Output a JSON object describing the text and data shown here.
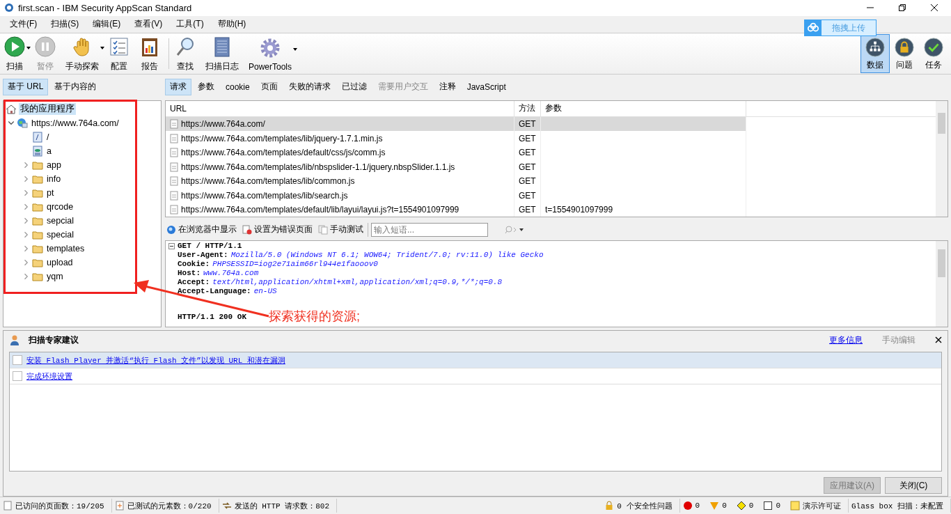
{
  "window": {
    "title": "first.scan - IBM Security AppScan Standard"
  },
  "menu": [
    "文件(F)",
    "扫描(S)",
    "编辑(E)",
    "查看(V)",
    "工具(T)",
    "帮助(H)"
  ],
  "toolbar": [
    {
      "label": "扫描",
      "disabled": false,
      "dropdown": true
    },
    {
      "label": "暂停",
      "disabled": true,
      "dropdown": false
    },
    {
      "label": "手动探索",
      "disabled": false,
      "dropdown": true
    },
    {
      "label": "配置",
      "disabled": false,
      "dropdown": false
    },
    {
      "label": "报告",
      "disabled": false,
      "dropdown": false
    },
    {
      "label": "查找",
      "disabled": false,
      "dropdown": false
    },
    {
      "label": "扫描日志",
      "disabled": false,
      "dropdown": false
    },
    {
      "label": "PowerTools",
      "disabled": false,
      "dropdown": true
    }
  ],
  "views": [
    {
      "label": "数据",
      "selected": true
    },
    {
      "label": "问题",
      "selected": false
    },
    {
      "label": "任务",
      "selected": false
    }
  ],
  "upload_widget": {
    "label": "拖拽上传"
  },
  "left_tabs": [
    {
      "label": "基于 URL",
      "selected": true
    },
    {
      "label": "基于内容的",
      "selected": false
    }
  ],
  "tree": [
    {
      "label": "我的应用程序",
      "kind": "home",
      "selected": true,
      "children": [
        {
          "label": "https://www.764a.com/",
          "kind": "site",
          "selected": false,
          "expanded": true,
          "children": [
            {
              "label": "/",
              "kind": "page",
              "selected": false
            },
            {
              "label": "a",
              "kind": "script",
              "selected": false
            },
            {
              "label": "app",
              "kind": "folder",
              "selected": false,
              "expanded": false
            },
            {
              "label": "info",
              "kind": "folder",
              "selected": false,
              "expanded": false
            },
            {
              "label": "pt",
              "kind": "folder",
              "selected": false,
              "expanded": false
            },
            {
              "label": "qrcode",
              "kind": "folder",
              "selected": false,
              "expanded": false
            },
            {
              "label": "sepcial",
              "kind": "folder",
              "selected": false,
              "expanded": false
            },
            {
              "label": "special",
              "kind": "folder",
              "selected": false,
              "expanded": false
            },
            {
              "label": "templates",
              "kind": "folder",
              "selected": false,
              "expanded": false
            },
            {
              "label": "upload",
              "kind": "folder",
              "selected": false,
              "expanded": false
            },
            {
              "label": "yqm",
              "kind": "folder",
              "selected": false,
              "expanded": false
            }
          ]
        }
      ]
    }
  ],
  "right_tabs": [
    {
      "label": "请求",
      "selected": true,
      "disabled": false
    },
    {
      "label": "参数",
      "selected": false,
      "disabled": false
    },
    {
      "label": "cookie",
      "selected": false,
      "disabled": false
    },
    {
      "label": "页面",
      "selected": false,
      "disabled": false
    },
    {
      "label": "失败的请求",
      "selected": false,
      "disabled": false
    },
    {
      "label": "已过滤",
      "selected": false,
      "disabled": false
    },
    {
      "label": "需要用户交互",
      "selected": false,
      "disabled": true
    },
    {
      "label": "注释",
      "selected": false,
      "disabled": false
    },
    {
      "label": "JavaScript",
      "selected": false,
      "disabled": false
    }
  ],
  "table": {
    "columns": [
      "URL",
      "方法",
      "参数"
    ],
    "rows": [
      {
        "url": "https://www.764a.com/",
        "method": "GET",
        "selected": true
      },
      {
        "url": "https://www.764a.com/templates/lib/jquery-1.7.1.min.js",
        "method": "GET",
        "selected": false
      },
      {
        "url": "https://www.764a.com/templates/default/css/js/comm.js",
        "method": "GET",
        "selected": false
      },
      {
        "url": "https://www.764a.com/templates/lib/nbspslider-1.1/jquery.nbspSlider.1.1.js",
        "method": "GET",
        "selected": false
      },
      {
        "url": "https://www.764a.com/templates/lib/common.js",
        "method": "GET",
        "selected": false
      },
      {
        "url": "https://www.764a.com/templates/lib/search.js",
        "method": "GET",
        "selected": false
      },
      {
        "url": "https://www.764a.com/templates/default/lib/layui/layui.js?t=1554901097999",
        "method": "GET",
        "params": "t=1554901097999",
        "selected": false
      }
    ]
  },
  "request_toolbar": {
    "buttons": [
      "在浏览器中显示",
      "设置为错误页面",
      "手动测试"
    ],
    "search": {
      "placeholder": "输入短语..."
    }
  },
  "request": {
    "start_line": "GET / HTTP/1.1",
    "headers": [
      {
        "name": "User-Agent:",
        "value": "Mozilla/5.0 (Windows NT 6.1; WOW64; Trident/7.0; rv:11.0) like Gecko"
      },
      {
        "name": "Cookie:",
        "value": "PHPSESSID=iog2e71aim66rl944e1faooov0"
      },
      {
        "name": "Host:",
        "value": "www.764a.com"
      },
      {
        "name": "Accept:",
        "value": "text/html,application/xhtml+xml,application/xml;q=0.9,*/*;q=0.8"
      },
      {
        "name": "Accept-Language:",
        "value": "en-US"
      }
    ],
    "response_line": "HTTP/1.1 200 OK"
  },
  "annotation": {
    "text": "探索获得的资源;"
  },
  "advisor": {
    "title": "扫描专家建议",
    "more_link": "更多信息",
    "manual_edit": {
      "label": "手动编辑",
      "disabled": true
    },
    "items": [
      {
        "text": "安装 Flash Player 并激活“执行 Flash 文件”以发现 URL 和潜在漏洞",
        "checked": false,
        "selected": true
      },
      {
        "text": "完成环境设置",
        "checked": false,
        "selected": false
      }
    ],
    "buttons": [
      {
        "label": "应用建议(A)",
        "disabled": true
      },
      {
        "label": "关闭(C)",
        "disabled": false
      }
    ]
  },
  "status_bar": {
    "visited": "已访问的页面数：19/205",
    "tested": "已测试的元素数：0/220",
    "requests": "发送的 HTTP 请求数：802",
    "issues": "0 个安全性问题",
    "severities": [
      {
        "count": "0",
        "color": "#e00000"
      },
      {
        "count": "0",
        "color": "#f0a000"
      },
      {
        "count": "0",
        "color": "#f5e000"
      },
      {
        "count": "0",
        "color": "#ffffff"
      }
    ],
    "license": "演示许可证",
    "glass_box": "Glass box 扫描：未配置"
  }
}
